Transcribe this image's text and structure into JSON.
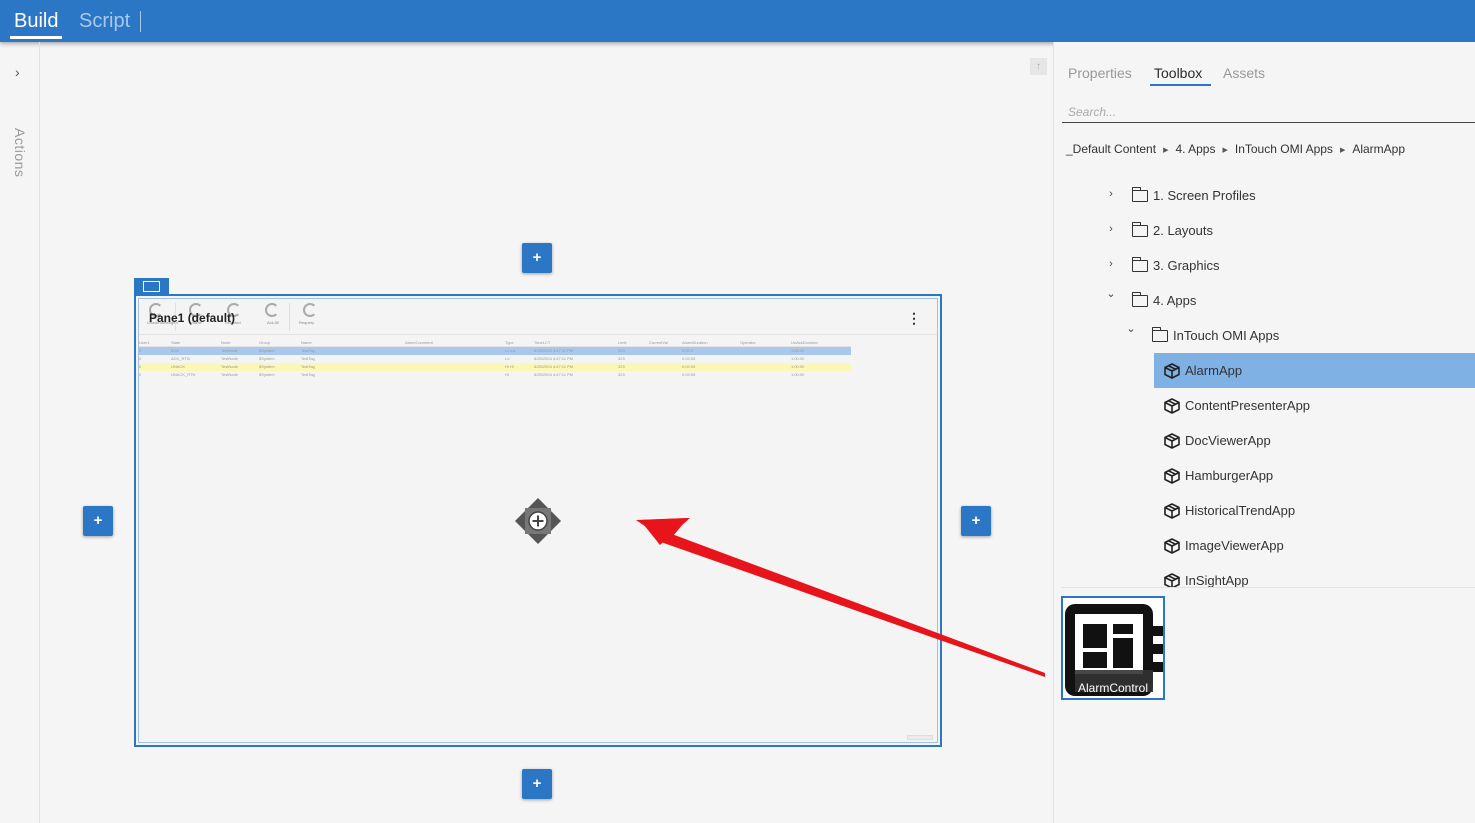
{
  "top_tabs": {
    "build": "Build",
    "script": "Script"
  },
  "actions": {
    "label": "Actions"
  },
  "canvas": {
    "pane_title": "Pane1 (default)",
    "toolbar": {
      "b1": "Unacknowledged",
      "b2": "Visible",
      "b3": "Selected",
      "b4": "Ack All",
      "b5": "Requery"
    },
    "table_headers": [
      "User1",
      "State",
      "Node",
      "Group",
      "Name",
      "AlarmComment",
      "Type",
      "TimeLCT",
      "Limit",
      "CurrentVal",
      "AlarmDuration",
      "Operator",
      "UnAckDuration"
    ],
    "table_rows": [
      [
        "0",
        "ACK",
        "TestNode",
        "$System",
        "TestTag",
        "",
        "Lo Lo",
        "6/25/2024 4:47:11 PM",
        "323",
        "",
        "0:02:0",
        "",
        "1:00:00"
      ],
      [
        "0",
        "ACK_RTN",
        "TestNode",
        "$System",
        "TestTag",
        "",
        "Lo",
        "6/25/2024 4:47:11 PM",
        "323",
        "",
        "0:02:05",
        "",
        "1:00:00"
      ],
      [
        "0",
        "UNACK",
        "TestNode",
        "$System",
        "TestTag",
        "",
        "Hi Hi",
        "6/25/2024 4:47:11 PM",
        "323",
        "",
        "0:02:05",
        "",
        "1:00:00"
      ],
      [
        "0",
        "UNACK_RTN",
        "TestNode",
        "$System",
        "TestTag",
        "",
        "Hi",
        "6/25/2024 4:47:11 PM",
        "323",
        "",
        "0:02:05",
        "",
        "1:00:00"
      ]
    ],
    "add_label": "+"
  },
  "right_panel": {
    "tabs": {
      "properties": "Properties",
      "toolbox": "Toolbox",
      "assets": "Assets"
    },
    "active_tab": "Toolbox",
    "search_placeholder": "Search...",
    "breadcrumb": [
      "_Default Content",
      "4. Apps",
      "InTouch OMI Apps",
      "AlarmApp"
    ],
    "tree": [
      {
        "label": "1. Screen Profiles",
        "type": "folder",
        "expanded": false
      },
      {
        "label": "2. Layouts",
        "type": "folder",
        "expanded": false
      },
      {
        "label": "3. Graphics",
        "type": "folder",
        "expanded": false
      },
      {
        "label": "4. Apps",
        "type": "folder",
        "expanded": true
      },
      {
        "label": "InTouch OMI Apps",
        "type": "folder",
        "expanded": true
      },
      {
        "label": "AlarmApp",
        "type": "app",
        "selected": true
      },
      {
        "label": "ContentPresenterApp",
        "type": "app"
      },
      {
        "label": "DocViewerApp",
        "type": "app"
      },
      {
        "label": "HamburgerApp",
        "type": "app"
      },
      {
        "label": "HistoricalTrendApp",
        "type": "app"
      },
      {
        "label": "ImageViewerApp",
        "type": "app"
      },
      {
        "label": "InSightApp",
        "type": "app"
      }
    ],
    "tile": {
      "label": "AlarmControl"
    }
  },
  "colors": {
    "accent": "#2b77c6",
    "selected_row": "#7fb1e5",
    "annotation_arrow": "#e8141c"
  }
}
